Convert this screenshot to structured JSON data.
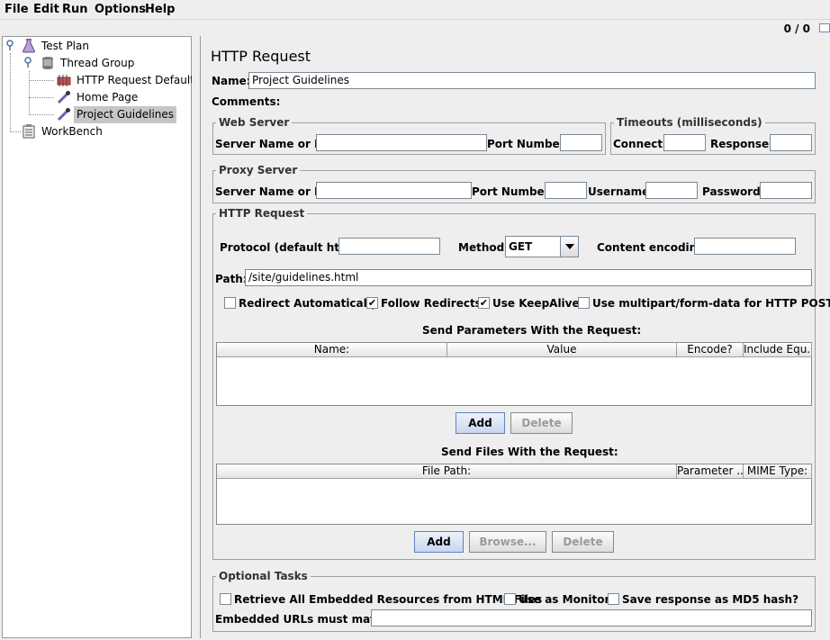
{
  "menu": {
    "file": "File",
    "edit": "Edit",
    "run": "Run",
    "options": "Options",
    "help": "Help"
  },
  "status": {
    "counter": "0 / 0"
  },
  "tree": {
    "test_plan": "Test Plan",
    "thread_group": "Thread Group",
    "http_defaults": "HTTP Request Defaults",
    "home_page": "Home Page",
    "project_guidelines": "Project Guidelines",
    "workbench": "WorkBench"
  },
  "panel": {
    "title": "HTTP Request",
    "name_label": "Name:",
    "name_value": "Project Guidelines",
    "comments_label": "Comments:"
  },
  "web_server": {
    "title": "Web Server",
    "server_label": "Server Name or IP:",
    "port_label": "Port Number:"
  },
  "timeouts": {
    "title": "Timeouts (milliseconds)",
    "connect_label": "Connect:",
    "response_label": "Response:"
  },
  "proxy": {
    "title": "Proxy Server",
    "server_label": "Server Name or IP:",
    "port_label": "Port Number:",
    "username_label": "Username",
    "password_label": "Password"
  },
  "http": {
    "title": "HTTP Request",
    "protocol_label": "Protocol (default http):",
    "method_label": "Method:",
    "method_value": "GET",
    "encoding_label": "Content encoding:",
    "path_label": "Path:",
    "path_value": "/site/guidelines.html",
    "redirect_auto": "Redirect Automatically",
    "follow_redirects": "Follow Redirects",
    "keepalive": "Use KeepAlive",
    "multipart": "Use multipart/form-data for HTTP POST",
    "params_title": "Send Parameters With the Request:",
    "params_cols": [
      "Name:",
      "Value",
      "Encode?",
      "Include Equ..."
    ],
    "files_title": "Send Files With the Request:",
    "files_cols": [
      "File Path:",
      "Parameter ...",
      "MIME Type:"
    ],
    "add": "Add",
    "delete": "Delete",
    "browse": "Browse..."
  },
  "optional": {
    "title": "Optional Tasks",
    "retrieve": "Retrieve All Embedded Resources from HTML Files",
    "monitor": "Use as Monitor",
    "md5": "Save response as MD5 hash?",
    "embedded_label": "Embedded URLs must match:"
  },
  "checks": {
    "check_mark": "✔"
  }
}
